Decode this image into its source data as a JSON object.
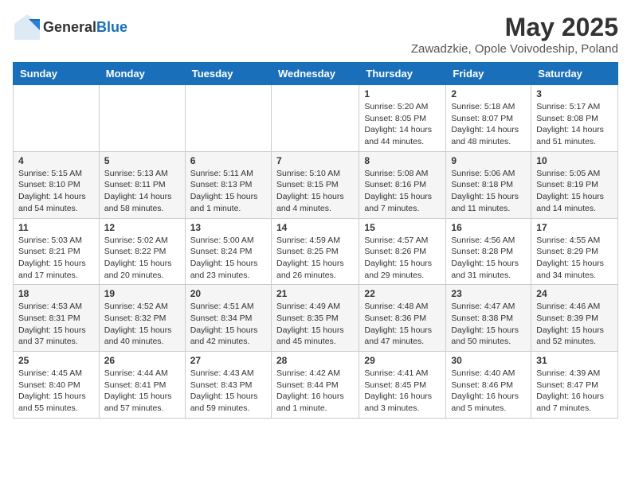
{
  "header": {
    "logo_general": "General",
    "logo_blue": "Blue",
    "title": "May 2025",
    "subtitle": "Zawadzkie, Opole Voivodeship, Poland"
  },
  "calendar": {
    "days_of_week": [
      "Sunday",
      "Monday",
      "Tuesday",
      "Wednesday",
      "Thursday",
      "Friday",
      "Saturday"
    ],
    "weeks": [
      [
        {
          "day": "",
          "info": ""
        },
        {
          "day": "",
          "info": ""
        },
        {
          "day": "",
          "info": ""
        },
        {
          "day": "",
          "info": ""
        },
        {
          "day": "1",
          "info": "Sunrise: 5:20 AM\nSunset: 8:05 PM\nDaylight: 14 hours and 44 minutes."
        },
        {
          "day": "2",
          "info": "Sunrise: 5:18 AM\nSunset: 8:07 PM\nDaylight: 14 hours and 48 minutes."
        },
        {
          "day": "3",
          "info": "Sunrise: 5:17 AM\nSunset: 8:08 PM\nDaylight: 14 hours and 51 minutes."
        }
      ],
      [
        {
          "day": "4",
          "info": "Sunrise: 5:15 AM\nSunset: 8:10 PM\nDaylight: 14 hours and 54 minutes."
        },
        {
          "day": "5",
          "info": "Sunrise: 5:13 AM\nSunset: 8:11 PM\nDaylight: 14 hours and 58 minutes."
        },
        {
          "day": "6",
          "info": "Sunrise: 5:11 AM\nSunset: 8:13 PM\nDaylight: 15 hours and 1 minute."
        },
        {
          "day": "7",
          "info": "Sunrise: 5:10 AM\nSunset: 8:15 PM\nDaylight: 15 hours and 4 minutes."
        },
        {
          "day": "8",
          "info": "Sunrise: 5:08 AM\nSunset: 8:16 PM\nDaylight: 15 hours and 7 minutes."
        },
        {
          "day": "9",
          "info": "Sunrise: 5:06 AM\nSunset: 8:18 PM\nDaylight: 15 hours and 11 minutes."
        },
        {
          "day": "10",
          "info": "Sunrise: 5:05 AM\nSunset: 8:19 PM\nDaylight: 15 hours and 14 minutes."
        }
      ],
      [
        {
          "day": "11",
          "info": "Sunrise: 5:03 AM\nSunset: 8:21 PM\nDaylight: 15 hours and 17 minutes."
        },
        {
          "day": "12",
          "info": "Sunrise: 5:02 AM\nSunset: 8:22 PM\nDaylight: 15 hours and 20 minutes."
        },
        {
          "day": "13",
          "info": "Sunrise: 5:00 AM\nSunset: 8:24 PM\nDaylight: 15 hours and 23 minutes."
        },
        {
          "day": "14",
          "info": "Sunrise: 4:59 AM\nSunset: 8:25 PM\nDaylight: 15 hours and 26 minutes."
        },
        {
          "day": "15",
          "info": "Sunrise: 4:57 AM\nSunset: 8:26 PM\nDaylight: 15 hours and 29 minutes."
        },
        {
          "day": "16",
          "info": "Sunrise: 4:56 AM\nSunset: 8:28 PM\nDaylight: 15 hours and 31 minutes."
        },
        {
          "day": "17",
          "info": "Sunrise: 4:55 AM\nSunset: 8:29 PM\nDaylight: 15 hours and 34 minutes."
        }
      ],
      [
        {
          "day": "18",
          "info": "Sunrise: 4:53 AM\nSunset: 8:31 PM\nDaylight: 15 hours and 37 minutes."
        },
        {
          "day": "19",
          "info": "Sunrise: 4:52 AM\nSunset: 8:32 PM\nDaylight: 15 hours and 40 minutes."
        },
        {
          "day": "20",
          "info": "Sunrise: 4:51 AM\nSunset: 8:34 PM\nDaylight: 15 hours and 42 minutes."
        },
        {
          "day": "21",
          "info": "Sunrise: 4:49 AM\nSunset: 8:35 PM\nDaylight: 15 hours and 45 minutes."
        },
        {
          "day": "22",
          "info": "Sunrise: 4:48 AM\nSunset: 8:36 PM\nDaylight: 15 hours and 47 minutes."
        },
        {
          "day": "23",
          "info": "Sunrise: 4:47 AM\nSunset: 8:38 PM\nDaylight: 15 hours and 50 minutes."
        },
        {
          "day": "24",
          "info": "Sunrise: 4:46 AM\nSunset: 8:39 PM\nDaylight: 15 hours and 52 minutes."
        }
      ],
      [
        {
          "day": "25",
          "info": "Sunrise: 4:45 AM\nSunset: 8:40 PM\nDaylight: 15 hours and 55 minutes."
        },
        {
          "day": "26",
          "info": "Sunrise: 4:44 AM\nSunset: 8:41 PM\nDaylight: 15 hours and 57 minutes."
        },
        {
          "day": "27",
          "info": "Sunrise: 4:43 AM\nSunset: 8:43 PM\nDaylight: 15 hours and 59 minutes."
        },
        {
          "day": "28",
          "info": "Sunrise: 4:42 AM\nSunset: 8:44 PM\nDaylight: 16 hours and 1 minute."
        },
        {
          "day": "29",
          "info": "Sunrise: 4:41 AM\nSunset: 8:45 PM\nDaylight: 16 hours and 3 minutes."
        },
        {
          "day": "30",
          "info": "Sunrise: 4:40 AM\nSunset: 8:46 PM\nDaylight: 16 hours and 5 minutes."
        },
        {
          "day": "31",
          "info": "Sunrise: 4:39 AM\nSunset: 8:47 PM\nDaylight: 16 hours and 7 minutes."
        }
      ]
    ]
  }
}
